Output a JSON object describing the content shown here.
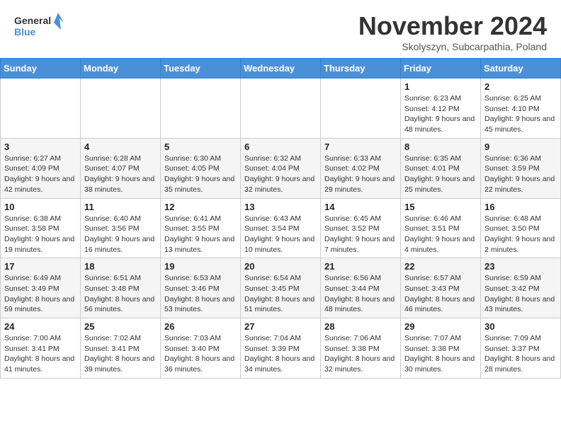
{
  "header": {
    "logo_line1": "General",
    "logo_line2": "Blue",
    "month_title": "November 2024",
    "location": "Skolyszyn, Subcarpathia, Poland"
  },
  "weekdays": [
    "Sunday",
    "Monday",
    "Tuesday",
    "Wednesday",
    "Thursday",
    "Friday",
    "Saturday"
  ],
  "weeks": [
    [
      {
        "day": "",
        "info": ""
      },
      {
        "day": "",
        "info": ""
      },
      {
        "day": "",
        "info": ""
      },
      {
        "day": "",
        "info": ""
      },
      {
        "day": "",
        "info": ""
      },
      {
        "day": "1",
        "info": "Sunrise: 6:23 AM\nSunset: 4:12 PM\nDaylight: 9 hours and 48 minutes."
      },
      {
        "day": "2",
        "info": "Sunrise: 6:25 AM\nSunset: 4:10 PM\nDaylight: 9 hours and 45 minutes."
      }
    ],
    [
      {
        "day": "3",
        "info": "Sunrise: 6:27 AM\nSunset: 4:09 PM\nDaylight: 9 hours and 42 minutes."
      },
      {
        "day": "4",
        "info": "Sunrise: 6:28 AM\nSunset: 4:07 PM\nDaylight: 9 hours and 38 minutes."
      },
      {
        "day": "5",
        "info": "Sunrise: 6:30 AM\nSunset: 4:05 PM\nDaylight: 9 hours and 35 minutes."
      },
      {
        "day": "6",
        "info": "Sunrise: 6:32 AM\nSunset: 4:04 PM\nDaylight: 9 hours and 32 minutes."
      },
      {
        "day": "7",
        "info": "Sunrise: 6:33 AM\nSunset: 4:02 PM\nDaylight: 9 hours and 29 minutes."
      },
      {
        "day": "8",
        "info": "Sunrise: 6:35 AM\nSunset: 4:01 PM\nDaylight: 9 hours and 25 minutes."
      },
      {
        "day": "9",
        "info": "Sunrise: 6:36 AM\nSunset: 3:59 PM\nDaylight: 9 hours and 22 minutes."
      }
    ],
    [
      {
        "day": "10",
        "info": "Sunrise: 6:38 AM\nSunset: 3:58 PM\nDaylight: 9 hours and 19 minutes."
      },
      {
        "day": "11",
        "info": "Sunrise: 6:40 AM\nSunset: 3:56 PM\nDaylight: 9 hours and 16 minutes."
      },
      {
        "day": "12",
        "info": "Sunrise: 6:41 AM\nSunset: 3:55 PM\nDaylight: 9 hours and 13 minutes."
      },
      {
        "day": "13",
        "info": "Sunrise: 6:43 AM\nSunset: 3:54 PM\nDaylight: 9 hours and 10 minutes."
      },
      {
        "day": "14",
        "info": "Sunrise: 6:45 AM\nSunset: 3:52 PM\nDaylight: 9 hours and 7 minutes."
      },
      {
        "day": "15",
        "info": "Sunrise: 6:46 AM\nSunset: 3:51 PM\nDaylight: 9 hours and 4 minutes."
      },
      {
        "day": "16",
        "info": "Sunrise: 6:48 AM\nSunset: 3:50 PM\nDaylight: 9 hours and 2 minutes."
      }
    ],
    [
      {
        "day": "17",
        "info": "Sunrise: 6:49 AM\nSunset: 3:49 PM\nDaylight: 8 hours and 59 minutes."
      },
      {
        "day": "18",
        "info": "Sunrise: 6:51 AM\nSunset: 3:48 PM\nDaylight: 8 hours and 56 minutes."
      },
      {
        "day": "19",
        "info": "Sunrise: 6:53 AM\nSunset: 3:46 PM\nDaylight: 8 hours and 53 minutes."
      },
      {
        "day": "20",
        "info": "Sunrise: 6:54 AM\nSunset: 3:45 PM\nDaylight: 8 hours and 51 minutes."
      },
      {
        "day": "21",
        "info": "Sunrise: 6:56 AM\nSunset: 3:44 PM\nDaylight: 8 hours and 48 minutes."
      },
      {
        "day": "22",
        "info": "Sunrise: 6:57 AM\nSunset: 3:43 PM\nDaylight: 8 hours and 46 minutes."
      },
      {
        "day": "23",
        "info": "Sunrise: 6:59 AM\nSunset: 3:42 PM\nDaylight: 8 hours and 43 minutes."
      }
    ],
    [
      {
        "day": "24",
        "info": "Sunrise: 7:00 AM\nSunset: 3:41 PM\nDaylight: 8 hours and 41 minutes."
      },
      {
        "day": "25",
        "info": "Sunrise: 7:02 AM\nSunset: 3:41 PM\nDaylight: 8 hours and 39 minutes."
      },
      {
        "day": "26",
        "info": "Sunrise: 7:03 AM\nSunset: 3:40 PM\nDaylight: 8 hours and 36 minutes."
      },
      {
        "day": "27",
        "info": "Sunrise: 7:04 AM\nSunset: 3:39 PM\nDaylight: 8 hours and 34 minutes."
      },
      {
        "day": "28",
        "info": "Sunrise: 7:06 AM\nSunset: 3:38 PM\nDaylight: 8 hours and 32 minutes."
      },
      {
        "day": "29",
        "info": "Sunrise: 7:07 AM\nSunset: 3:38 PM\nDaylight: 8 hours and 30 minutes."
      },
      {
        "day": "30",
        "info": "Sunrise: 7:09 AM\nSunset: 3:37 PM\nDaylight: 8 hours and 28 minutes."
      }
    ]
  ]
}
